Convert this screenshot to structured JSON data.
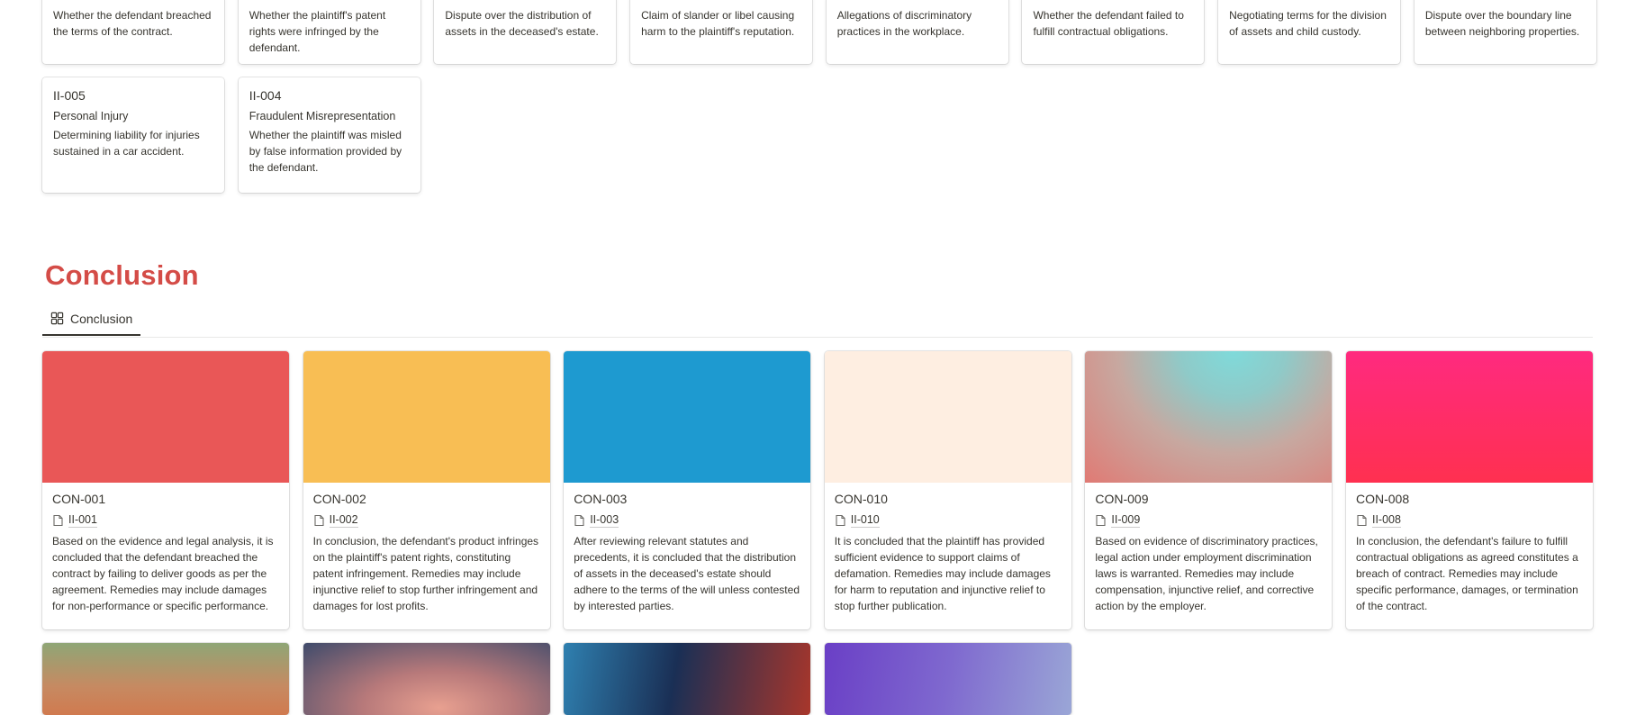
{
  "issues": [
    {
      "id": "",
      "category": "",
      "description": "Whether the defendant breached the terms of the contract."
    },
    {
      "id": "",
      "category": "",
      "description": "Whether the plaintiff's patent rights were infringed by the defendant."
    },
    {
      "id": "",
      "category": "",
      "description": "Dispute over the distribution of assets in the deceased's estate."
    },
    {
      "id": "",
      "category": "",
      "description": "Claim of slander or libel causing harm to the plaintiff's reputation."
    },
    {
      "id": "",
      "category": "",
      "description": "Allegations of discriminatory practices in the workplace."
    },
    {
      "id": "",
      "category": "",
      "description": "Whether the defendant failed to fulfill contractual obligations."
    },
    {
      "id": "",
      "category": "",
      "description": "Negotiating terms for the division of assets and child custody."
    },
    {
      "id": "",
      "category": "",
      "description": "Dispute over the boundary line between neighboring properties."
    },
    {
      "id": "II-005",
      "category": "Personal Injury",
      "description": "Determining liability for injuries sustained in a car accident."
    },
    {
      "id": "II-004",
      "category": "Fraudulent Misrepresentation",
      "description": "Whether the plaintiff was misled by false information provided by the defendant."
    }
  ],
  "section": {
    "title": "Conclusion",
    "title_color": "#d44c47"
  },
  "tabs": [
    {
      "label": "Conclusion",
      "icon": "gallery-view-icon"
    }
  ],
  "conclusions": [
    {
      "id": "CON-001",
      "related": "II-001",
      "cover": "linear-gradient(#e95757, #e95757)",
      "text": "Based on the evidence and legal analysis, it is concluded that the defendant breached the contract by failing to deliver goods as per the agreement. Remedies may include damages for non-performance or specific performance."
    },
    {
      "id": "CON-002",
      "related": "II-002",
      "cover": "linear-gradient(#f8be54, #f8be54)",
      "text": "In conclusion, the defendant's product infringes on the plaintiff's patent rights, constituting patent infringement. Remedies may include injunctive relief to stop further infringement and damages for lost profits."
    },
    {
      "id": "CON-003",
      "related": "II-003",
      "cover": "linear-gradient(#1e9ad0, #1e9ad0)",
      "text": "After reviewing relevant statutes and precedents, it is concluded that the distribution of assets in the deceased's estate should adhere to the terms of the will unless contested by interested parties."
    },
    {
      "id": "CON-010",
      "related": "II-010",
      "cover": "linear-gradient(#feeee1, #feeee1)",
      "text": "It is concluded that the plaintiff has provided sufficient evidence to support claims of defamation. Remedies may include damages for harm to reputation and injunctive relief to stop further publication."
    },
    {
      "id": "CON-009",
      "related": "II-009",
      "cover": "radial-gradient(ellipse at 60% 0%, #7fdada 0%, #8fcac8 25%, #c7a8a0 55%, #e07a74 100%)",
      "text": "Based on evidence of discriminatory practices, legal action under employment discrimination laws is warranted. Remedies may include compensation, injunctive relief, and corrective action by the employer."
    },
    {
      "id": "CON-008",
      "related": "II-008",
      "cover": "linear-gradient(#ff2a7f, #ff3050)",
      "text": "In conclusion, the defendant's failure to fulfill contractual obligations as agreed constitutes a breach of contract. Remedies may include specific performance, damages, or termination of the contract."
    }
  ],
  "partial_covers": [
    "linear-gradient(#8fa676 0%, #c68a62 60%, #d07a4f 100%)",
    "radial-gradient(ellipse at 55% 90%, #e8a090 0%, #b7797a 40%, #3f4b6b 100%)",
    "linear-gradient(100deg, #2f80b0 0%, #1a2f55 45%, #a8362b 100%)",
    "linear-gradient(100deg, #6a3fc6 0%, #7f69cf 50%, #9aa6d6 100%)"
  ]
}
